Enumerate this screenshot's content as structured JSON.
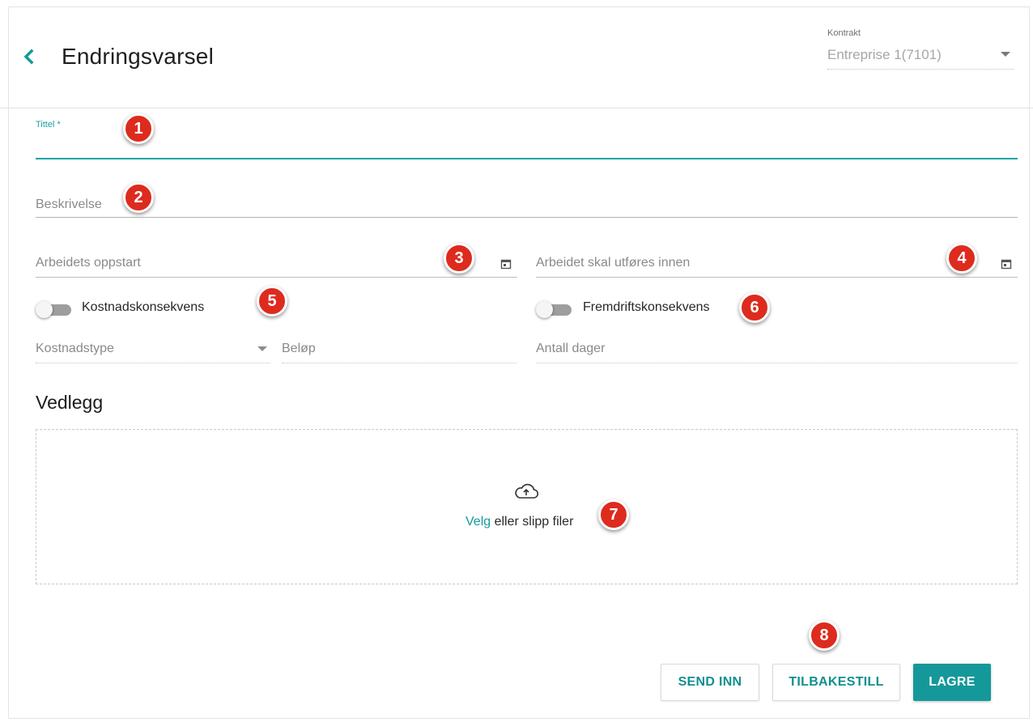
{
  "header": {
    "title": "Endringsvarsel",
    "contract_label": "Kontrakt",
    "contract_value": "Entreprise 1(7101)"
  },
  "form": {
    "tittel_label": "Tittel *",
    "tittel_value": "",
    "beskrivelse_placeholder": "Beskrivelse",
    "oppstart_placeholder": "Arbeidets oppstart",
    "innen_placeholder": "Arbeidet skal utføres innen",
    "kostnad_toggle_label": "Kostnadskonsekvens",
    "kostnad_toggle_on": false,
    "fremdrift_toggle_label": "Fremdriftskonsekvens",
    "fremdrift_toggle_on": false,
    "kostnadstype_placeholder": "Kostnadstype",
    "belop_placeholder": "Beløp",
    "antall_dager_placeholder": "Antall dager"
  },
  "attachments": {
    "title": "Vedlegg",
    "link_text": "Velg",
    "rest_text": " eller slipp filer"
  },
  "buttons": {
    "send_inn": "SEND INN",
    "tilbakestill": "TILBAKESTILL",
    "lagre": "LAGRE"
  },
  "markers": [
    "1",
    "2",
    "3",
    "4",
    "5",
    "6",
    "7",
    "8"
  ],
  "colors": {
    "accent": "#15989a",
    "marker": "#dd2b1e"
  },
  "icons": {
    "back": "chevron-left-icon",
    "calendar": "calendar-icon",
    "upload": "cloud-upload-icon",
    "dropdown": "caret-down-icon"
  }
}
